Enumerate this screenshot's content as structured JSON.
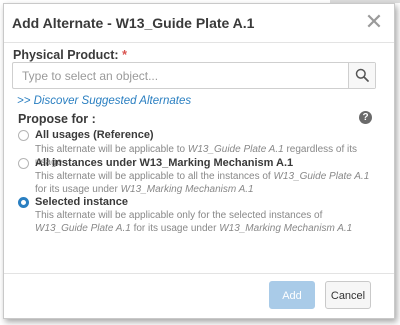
{
  "dialog": {
    "title": "Add Alternate - W13_Guide Plate A.1",
    "close_glyph": "✕"
  },
  "physical_product": {
    "label": "Physical Product:",
    "required_mark": "*",
    "placeholder": "Type to select an object...",
    "value": ""
  },
  "discover_link": ">> Discover Suggested Alternates",
  "propose": {
    "label": "Propose for :",
    "help_glyph": "?",
    "options": [
      {
        "title": "All usages (Reference)",
        "desc_pre": "This alternate will be applicable to ",
        "desc_em1": "W13_Guide Plate A.1",
        "desc_mid": " regardless of its usage",
        "desc_em2": "",
        "selected": false
      },
      {
        "title": "All instances under W13_Marking Mechanism A.1",
        "desc_pre": "This alternate will be applicable to all the instances of ",
        "desc_em1": "W13_Guide Plate A.1",
        "desc_mid": " for its usage under ",
        "desc_em2": "W13_Marking Mechanism A.1",
        "selected": false
      },
      {
        "title": "Selected instance",
        "desc_pre": "This alternate will be applicable only for the selected instances of ",
        "desc_em1": "W13_Guide Plate A.1",
        "desc_mid": " for its usage under ",
        "desc_em2": "W13_Marking Mechanism A.1",
        "selected": true
      }
    ]
  },
  "footer": {
    "add_label": "Add",
    "cancel_label": "Cancel"
  },
  "colors": {
    "accent": "#2a7fc1",
    "add_button_disabled": "#a9cbe8",
    "required": "#d9534f"
  },
  "icons": {
    "close": "close-icon",
    "search": "search-icon",
    "help": "help-icon"
  }
}
